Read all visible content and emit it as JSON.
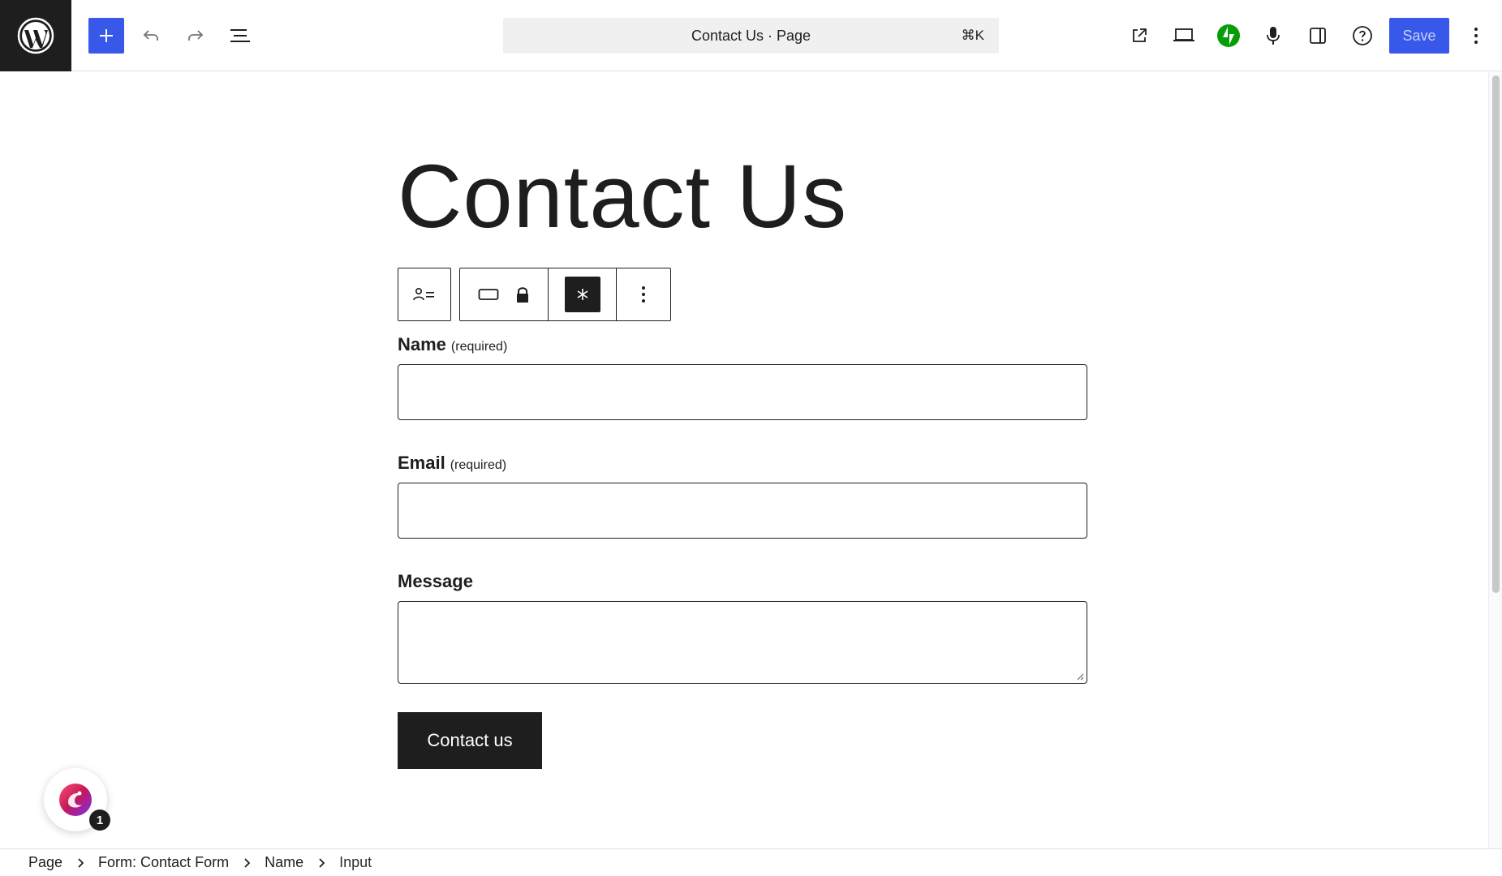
{
  "header": {
    "logo": "wordpress-logo",
    "inserter_icon": "plus-icon",
    "undo_icon": "undo-icon",
    "redo_icon": "redo-icon",
    "list_view_icon": "list-view-icon",
    "command_bar": {
      "title": "Contact Us · Page",
      "shortcut": "⌘K"
    },
    "right_icons": [
      "external-link-icon",
      "desktop-device-icon",
      "jetpack-icon",
      "microphone-icon",
      "sidebar-icon",
      "help-icon",
      "more-vertical-icon"
    ],
    "save_label": "Save"
  },
  "page": {
    "title": "Contact Us"
  },
  "block_toolbar": {
    "icons": [
      "contact-info-icon",
      "input-field-icon",
      "lock-icon",
      "required-asterisk-icon",
      "more-vertical-icon"
    ]
  },
  "form": {
    "fields": [
      {
        "label": "Name",
        "required_text": "(required)",
        "value": ""
      },
      {
        "label": "Email",
        "required_text": "(required)",
        "value": ""
      },
      {
        "label": "Message",
        "required_text": "",
        "value": ""
      }
    ],
    "submit_label": "Contact us"
  },
  "assistant": {
    "badge_count": "1"
  },
  "breadcrumb": [
    "Page",
    "Form: Contact Form",
    "Name",
    "Input"
  ],
  "colors": {
    "accent": "#3858e9",
    "dark": "#1e1e1e",
    "jetpack": "#069e08",
    "command_bar_bg": "#f0f0f0"
  }
}
